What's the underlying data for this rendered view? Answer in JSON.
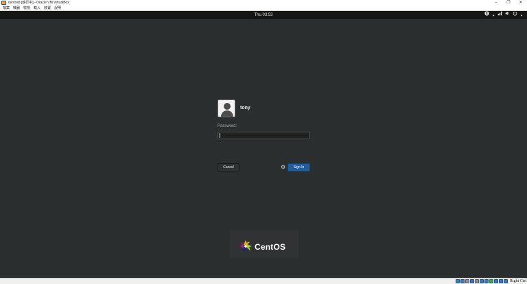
{
  "window": {
    "title": "centos8 [執行中] - Oracle VM VirtualBox",
    "controls": {
      "minimize": "–",
      "restore": "❐",
      "close": "✕"
    }
  },
  "menubar": {
    "items": [
      "檔案",
      "機器",
      "檢視",
      "輸入",
      "裝置",
      "說明"
    ]
  },
  "gnome": {
    "clock": "Thu 03:53",
    "accessibility_icon": "accessibility-icon",
    "network_icon": "network-icon",
    "volume_icon": "volume-icon",
    "power_icon": "power-icon"
  },
  "login": {
    "username": "tony",
    "password_label": "Password:",
    "password_value": "",
    "cancel_label": "Cancel",
    "signin_label": "Sign In",
    "session_icon": "gear-icon"
  },
  "branding": {
    "logo_text": "CentOS"
  },
  "statusbar": {
    "host_key": "Right Ctrl"
  }
}
